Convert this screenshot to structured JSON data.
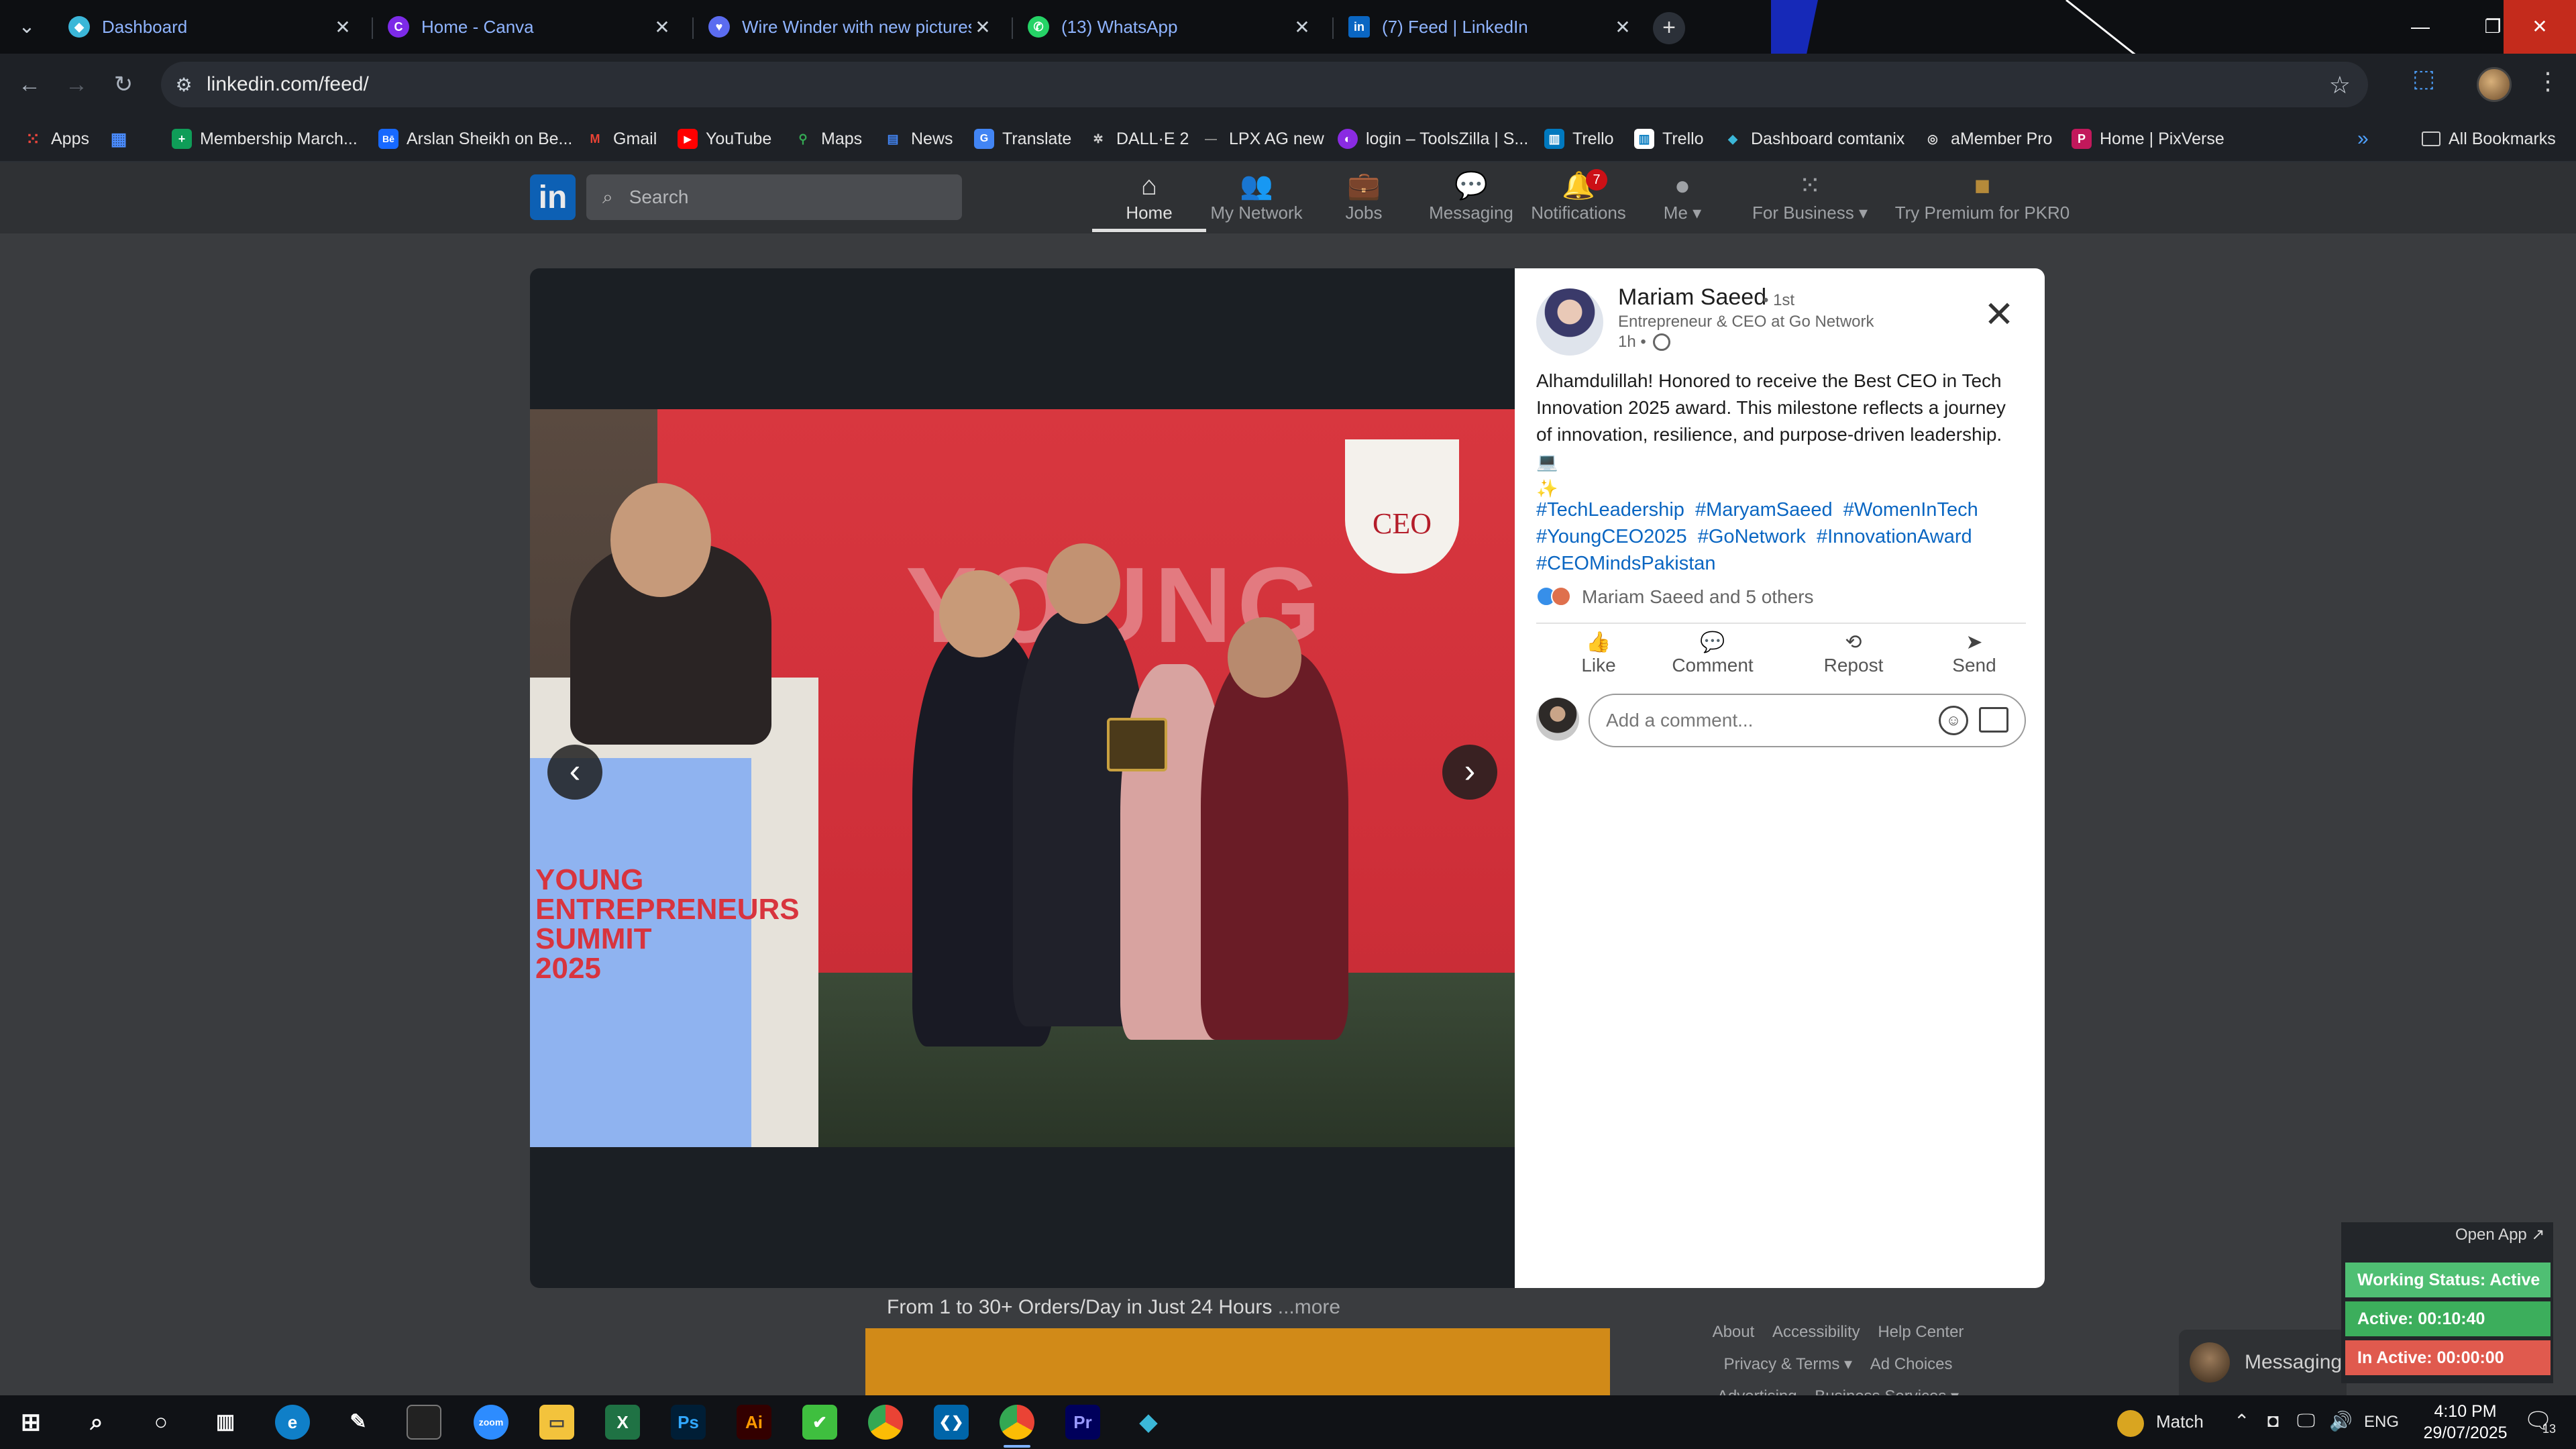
{
  "browser": {
    "tabs": [
      {
        "title": "Dashboard",
        "icon": "dashboard-favicon",
        "color": "#3bb7d8"
      },
      {
        "title": "Home - Canva",
        "icon": "canva-favicon",
        "color": "#7d2ae8"
      },
      {
        "title": "Wire Winder with new pictures",
        "icon": "heart-favicon",
        "color": "#5b6cf0"
      },
      {
        "title": "(13) WhatsApp",
        "icon": "whatsapp-favicon",
        "color": "#25d366"
      },
      {
        "title": "(7) Feed | LinkedIn",
        "icon": "linkedin-favicon",
        "color": "#0a66c2"
      }
    ],
    "url": "linkedin.com/feed/",
    "bookmarks": [
      {
        "label": "Apps",
        "icon": "apps-grid-icon",
        "color": "#e8453c"
      },
      {
        "label": "",
        "icon": "grid-icon",
        "color": "#4a8cff"
      },
      {
        "label": "Membership March...",
        "icon": "sheets-icon",
        "color": "#0f9d58"
      },
      {
        "label": "Arslan Sheikh on Be...",
        "icon": "behance-icon",
        "color": "#1769ff"
      },
      {
        "label": "Gmail",
        "icon": "gmail-icon",
        "color": "#ea4335"
      },
      {
        "label": "YouTube",
        "icon": "youtube-icon",
        "color": "#ff0000"
      },
      {
        "label": "Maps",
        "icon": "maps-icon",
        "color": "#34a853"
      },
      {
        "label": "News",
        "icon": "news-icon",
        "color": "#4285f4"
      },
      {
        "label": "Translate",
        "icon": "translate-icon",
        "color": "#4285f4"
      },
      {
        "label": "DALL·E 2",
        "icon": "openai-icon",
        "color": "#444444"
      },
      {
        "label": "LPX AG new",
        "icon": "dash-icon",
        "color": "#666666"
      },
      {
        "label": "login – ToolsZilla | S...",
        "icon": "toolszilla-icon",
        "color": "#8a2be2"
      },
      {
        "label": "Trello",
        "icon": "trello-icon",
        "color": "#0079bf"
      },
      {
        "label": "Trello",
        "icon": "trello-icon",
        "color": "#0079bf"
      },
      {
        "label": "Dashboard comtanix",
        "icon": "comtanix-icon",
        "color": "#3bb7d8"
      },
      {
        "label": "aMember Pro",
        "icon": "amember-icon",
        "color": "#dddddd"
      },
      {
        "label": "Home | PixVerse",
        "icon": "pixverse-icon",
        "color": "#c2185b"
      }
    ],
    "all_bookmarks": "All Bookmarks"
  },
  "linkedin": {
    "search_placeholder": "Search",
    "nav": [
      {
        "label": "Home",
        "icon": "home-icon"
      },
      {
        "label": "My Network",
        "icon": "network-icon"
      },
      {
        "label": "Jobs",
        "icon": "briefcase-icon"
      },
      {
        "label": "Messaging",
        "icon": "messaging-icon"
      },
      {
        "label": "Notifications",
        "icon": "bell-icon",
        "badge": "7"
      },
      {
        "label": "Me",
        "icon": "avatar-icon"
      },
      {
        "label": "For Business",
        "icon": "grid-icon"
      },
      {
        "label": "Try Premium for PKR0",
        "icon": "premium-icon"
      }
    ],
    "behind": {
      "promo_text": "From 1 to 30+ Orders/Day in Just 24 Hours",
      "promo_more": "...more",
      "footer": [
        "About",
        "Accessibility",
        "Help Center",
        "Privacy & Terms",
        "Ad Choices",
        "Advertising",
        "Business Services"
      ],
      "messaging_dock": "Messaging"
    }
  },
  "post": {
    "author": "Mariam Saeed",
    "degree": "• 1st",
    "headline": "Entrepreneur & CEO at Go Network",
    "time": "1h •",
    "body": "Alhamdulillah! Honored to receive the Best CEO in Tech Innovation 2025 award. This milestone reflects a journey of innovation, resilience, and purpose-driven leadership.",
    "hashtags": [
      "#TechLeadership",
      "#MaryamSaeed",
      "#WomenInTech",
      "#YoungCEO2025",
      "#GoNetwork",
      "#InnovationAward",
      "#CEOMindsPakistan"
    ],
    "reactions": "Mariam Saeed and 5 others",
    "actions": [
      "Like",
      "Comment",
      "Repost",
      "Send"
    ],
    "comment_placeholder": "Add a comment...",
    "photo_banner_left": "YOUNG ENTREPRENEURS SUMMIT 2025",
    "photo_ceo_logo": "CEO"
  },
  "working_status": {
    "open_app": "Open App ↗",
    "status": "Working Status: Active",
    "active": "Active: 00:10:40",
    "inactive": "In Active: 00:00:00",
    "colors": {
      "status": "#4fbf73",
      "active": "#3cae5c",
      "inactive": "#e05a4e"
    }
  },
  "taskbar": {
    "weather": "Match",
    "lang": "ENG",
    "time": "4:10 PM",
    "date": "29/07/2025",
    "notif_count": "13"
  }
}
